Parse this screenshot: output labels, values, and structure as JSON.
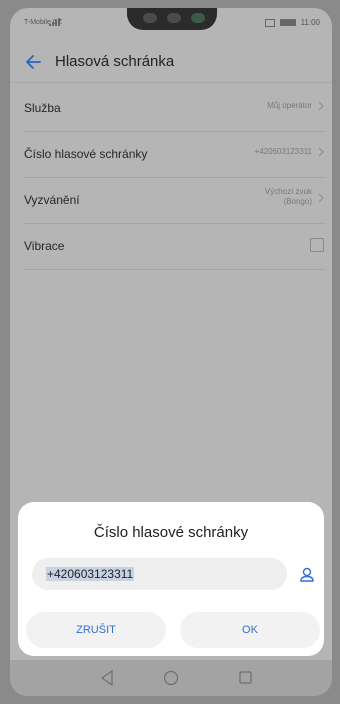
{
  "status_bar": {
    "carrier": "T-Mobile CZ",
    "time": "11:00"
  },
  "app_bar": {
    "title": "Hlasová schránka"
  },
  "settings": [
    {
      "label": "Služba",
      "value": "Můj operátor"
    },
    {
      "label": "Číslo hlasové schránky",
      "value": "+420603123311"
    },
    {
      "label": "Vyzvánění",
      "value_line1": "Výchozí zvuk",
      "value_line2": "(Bongo)"
    },
    {
      "label": "Vibrace"
    }
  ],
  "dialog": {
    "title": "Číslo hlasové schránky",
    "input_value": "+420603123311",
    "cancel_label": "ZRUŠIT",
    "ok_label": "OK"
  },
  "colors": {
    "accent": "#2f6fd6",
    "dim_overlay": "#b5b5b5"
  },
  "icons": {
    "back": "arrow-left-icon",
    "contact": "person-icon",
    "chevron": "chevron-right-icon"
  }
}
